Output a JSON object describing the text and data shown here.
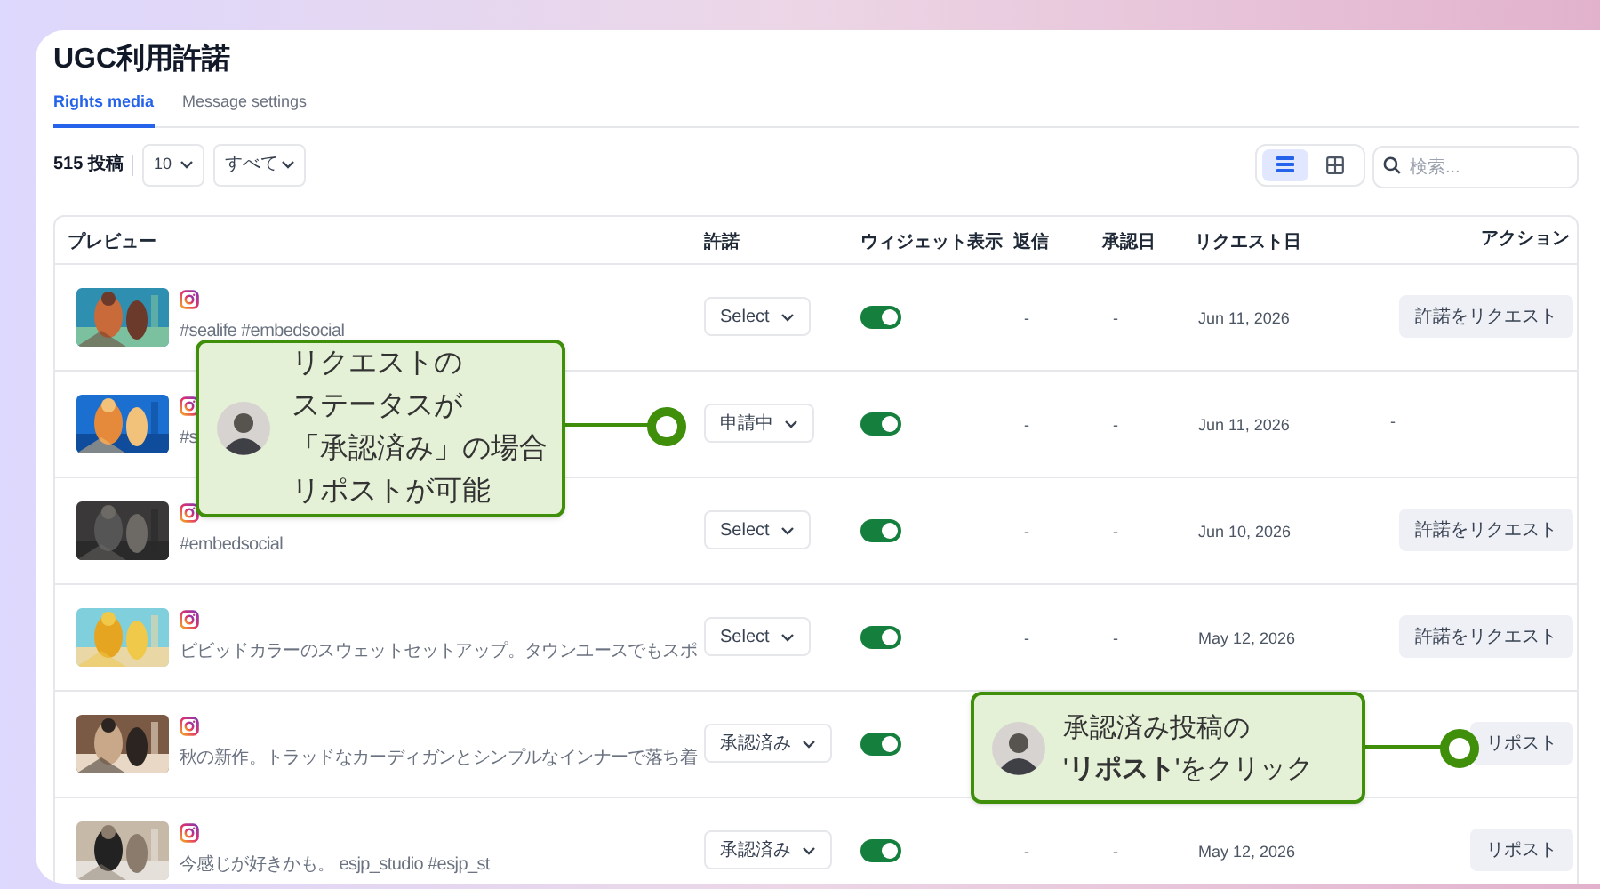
{
  "title": "UGC利用許諾",
  "tabs": [
    {
      "label": "Rights media",
      "selected": true
    },
    {
      "label": "Message settings",
      "selected": false
    }
  ],
  "toolbar": {
    "count": "515 投稿",
    "per_page": "10",
    "filter": "すべて",
    "views": [
      {
        "kind": "list",
        "selected": true
      },
      {
        "kind": "grid",
        "selected": false
      }
    ],
    "search": {
      "placeholder": "検索..."
    }
  },
  "table": {
    "columns": [
      "プレビュー",
      "許諾",
      "ウィジェット表示",
      "返信",
      "承認日",
      "リクエスト日",
      "アクション"
    ],
    "rows": [
      {
        "caption": "#sealife #embedsocial",
        "permission": "Select",
        "widget_on": true,
        "reply": "-",
        "approved": "-",
        "requested": "Jun 11, 2026",
        "action": {
          "kind": "button",
          "label": "許諾をリクエスト"
        }
      },
      {
        "caption": "#s",
        "permission": "申請中",
        "widget_on": true,
        "reply": "-",
        "approved": "-",
        "requested": "Jun 11, 2026",
        "action": {
          "kind": "text",
          "label": "-"
        }
      },
      {
        "caption": "#embedsocial",
        "permission": "Select",
        "widget_on": true,
        "reply": "-",
        "approved": "-",
        "requested": "Jun 10, 2026",
        "action": {
          "kind": "button",
          "label": "許諾をリクエスト"
        }
      },
      {
        "caption": "ビビッドカラーのスウェットセットアップ。タウンユースでもスポ",
        "permission": "Select",
        "widget_on": true,
        "reply": "-",
        "approved": "-",
        "requested": "May 12, 2026",
        "action": {
          "kind": "button",
          "label": "許諾をリクエスト"
        }
      },
      {
        "caption": "秋の新作。トラッドなカーディガンとシンプルなインナーで落ち着",
        "permission": "承認済み",
        "widget_on": true,
        "action": {
          "kind": "button",
          "label": "リポスト"
        }
      },
      {
        "caption": "今感じが好きかも。 esjp_studio #esjp_st",
        "permission": "承認済み",
        "widget_on": true,
        "reply": "-",
        "approved": "-",
        "requested": "May 12, 2026",
        "action": {
          "kind": "button",
          "label": "リポスト"
        }
      }
    ]
  },
  "callouts": [
    {
      "lines": [
        "リクエストの",
        "ステータスが",
        "「承認済み」の場合",
        "リポストが可能"
      ]
    },
    {
      "lines": [
        "承認済み投稿の",
        "'**リポスト**'をクリック"
      ]
    }
  ]
}
